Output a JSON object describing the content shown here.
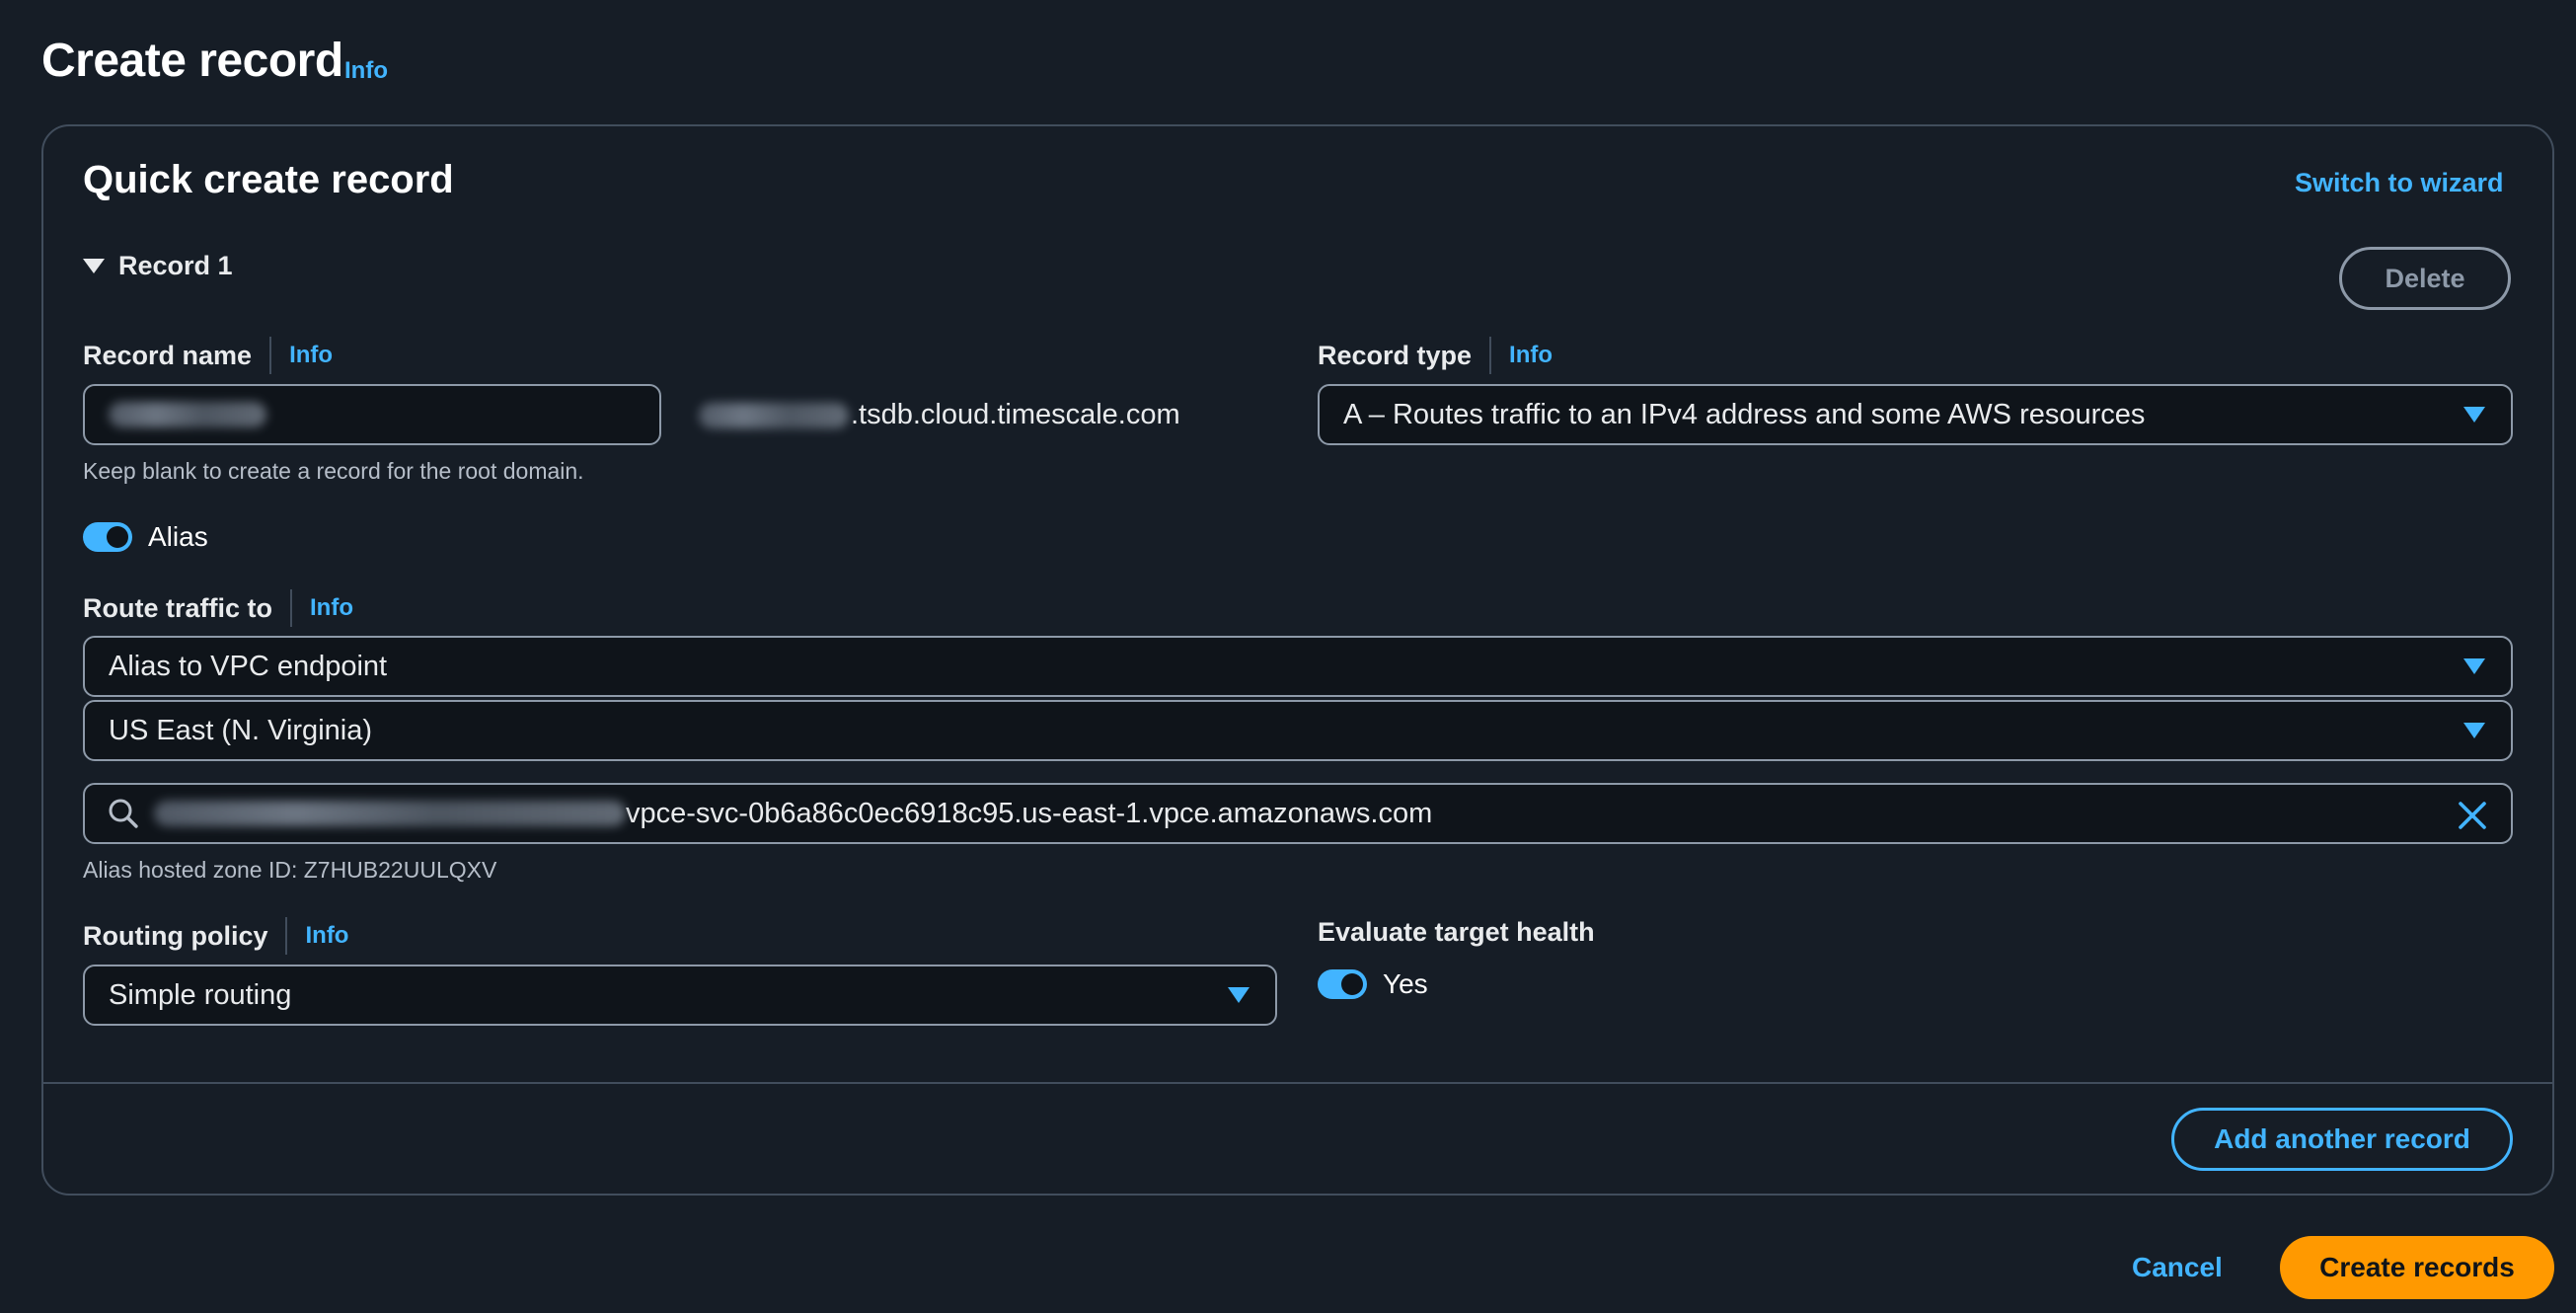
{
  "page": {
    "title": "Create record",
    "info_label": "Info"
  },
  "panel": {
    "title": "Quick create record",
    "switch_label": "Switch to wizard"
  },
  "record": {
    "header": "Record 1",
    "delete_label": "Delete",
    "record_name": {
      "label": "Record name",
      "info": "Info",
      "value": "",
      "domain_suffix": ".tsdb.cloud.timescale.com",
      "hint": "Keep blank to create a record for the root domain."
    },
    "record_type": {
      "label": "Record type",
      "info": "Info",
      "value": "A – Routes traffic to an IPv4 address and some AWS resources"
    },
    "alias": {
      "label": "Alias",
      "enabled": true
    },
    "route_traffic": {
      "label": "Route traffic to",
      "info": "Info",
      "endpoint_type": "Alias to VPC endpoint",
      "region": "US East (N. Virginia)",
      "search_value": "vpce-svc-0b6a86c0ec6918c95.us-east-1.vpce.amazonaws.com",
      "hosted_zone": "Alias hosted zone ID: Z7HUB22UULQXV"
    },
    "routing_policy": {
      "label": "Routing policy",
      "info": "Info",
      "value": "Simple routing"
    },
    "evaluate_health": {
      "label": "Evaluate target health",
      "value": "Yes",
      "enabled": true
    }
  },
  "actions": {
    "add_record": "Add another record",
    "cancel": "Cancel",
    "create": "Create records"
  },
  "colors": {
    "background": "#161d26",
    "accent": "#42b4ff",
    "primary_button": "#ff9900",
    "border": "#8d99a8"
  },
  "icons": [
    "caret-down-icon",
    "search-icon",
    "clear-icon",
    "select-caret-icon"
  ]
}
